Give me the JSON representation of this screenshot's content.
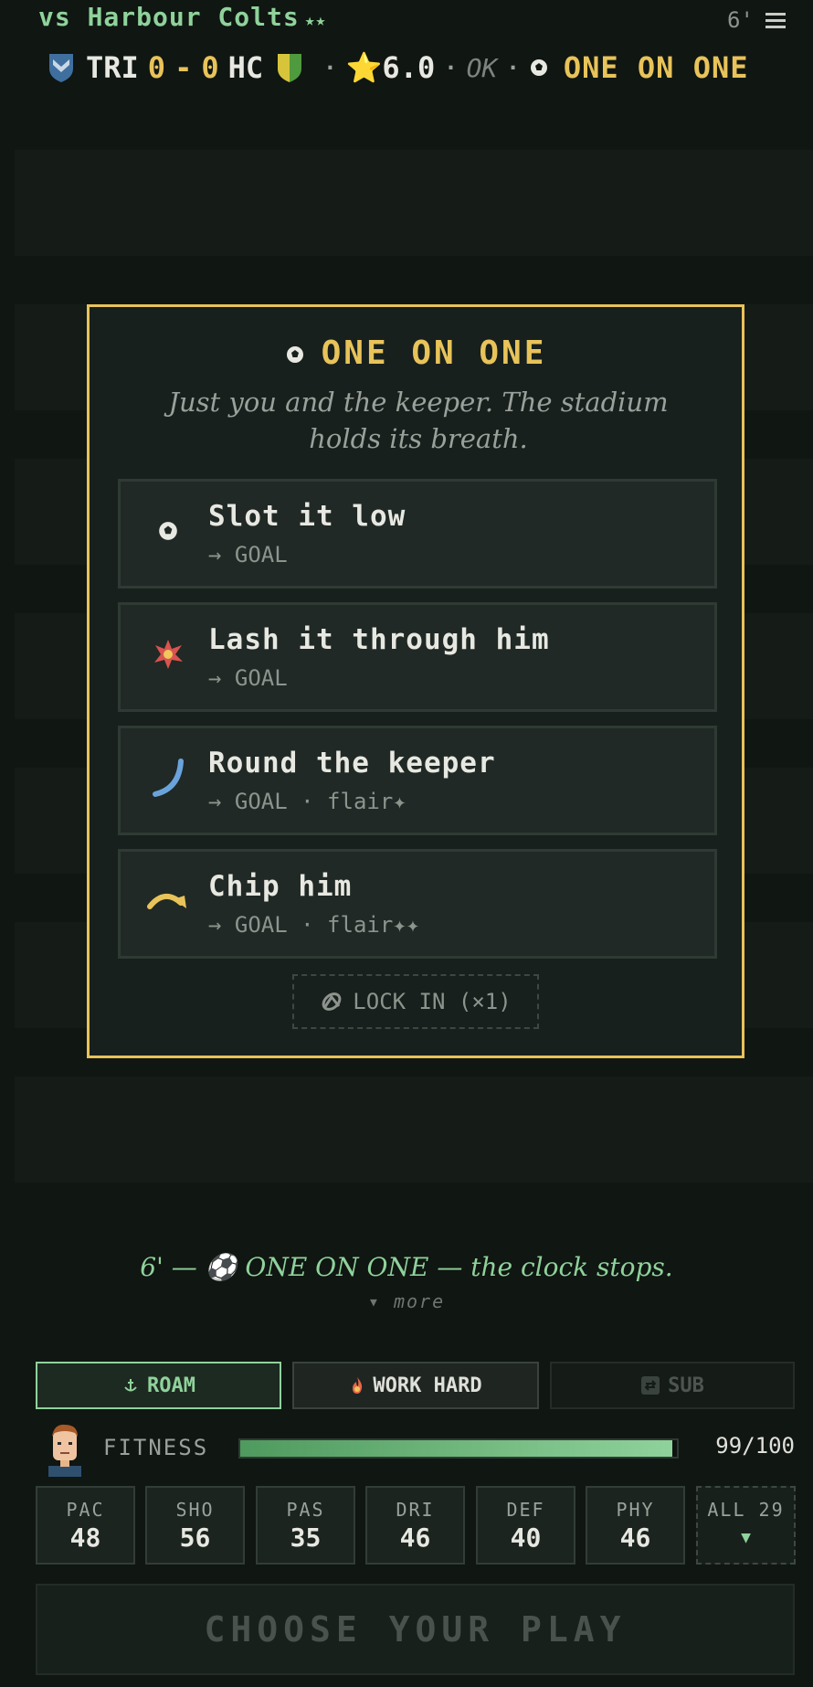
{
  "header": {
    "opponent_title": "vs Harbour Colts",
    "opponent_stars": "★★",
    "minute": "6'",
    "home_team": "TRI",
    "home_score": "0",
    "score_sep": "-",
    "away_score": "0",
    "away_team": "HC",
    "rating": "⭐6.0",
    "form": "OK",
    "event": "ONE ON ONE",
    "home_crest_color": "#3f6f9e",
    "away_crest_colors": [
      "#d8c43a",
      "#4f9a3e"
    ]
  },
  "modal": {
    "icon": "soccer-ball-icon",
    "title": "ONE ON ONE",
    "subtitle": "Just you and the keeper. The stadium holds its breath.",
    "options": [
      {
        "icon": "soccer-ball-icon",
        "label": "Slot it low",
        "outcome": "→ GOAL"
      },
      {
        "icon": "explosion-icon",
        "label": "Lash it through him",
        "outcome": "→ GOAL"
      },
      {
        "icon": "curve-icon",
        "label": "Round the keeper",
        "outcome": "→ GOAL · flair✦"
      },
      {
        "icon": "arrow-curve-icon",
        "label": "Chip him",
        "outcome": "→ GOAL · flair✦✦"
      }
    ],
    "lock_in": "LOCK IN (×1)"
  },
  "commentary": {
    "line": "6' — ⚽ ONE ON ONE — the clock stops.",
    "more": "▾ more"
  },
  "tactics": {
    "roam": "ROAM",
    "work_hard": "WORK HARD",
    "sub": "SUB"
  },
  "fitness": {
    "label": "FITNESS",
    "value_text": "99/100",
    "fraction": 0.99
  },
  "stats": [
    {
      "name": "PAC",
      "value": "48"
    },
    {
      "name": "SHO",
      "value": "56"
    },
    {
      "name": "PAS",
      "value": "35"
    },
    {
      "name": "DRI",
      "value": "46"
    },
    {
      "name": "DEF",
      "value": "40"
    },
    {
      "name": "PHY",
      "value": "46"
    }
  ],
  "stats_all": {
    "name": "ALL 29",
    "value": "▼"
  },
  "choose_label": "CHOOSE YOUR PLAY"
}
